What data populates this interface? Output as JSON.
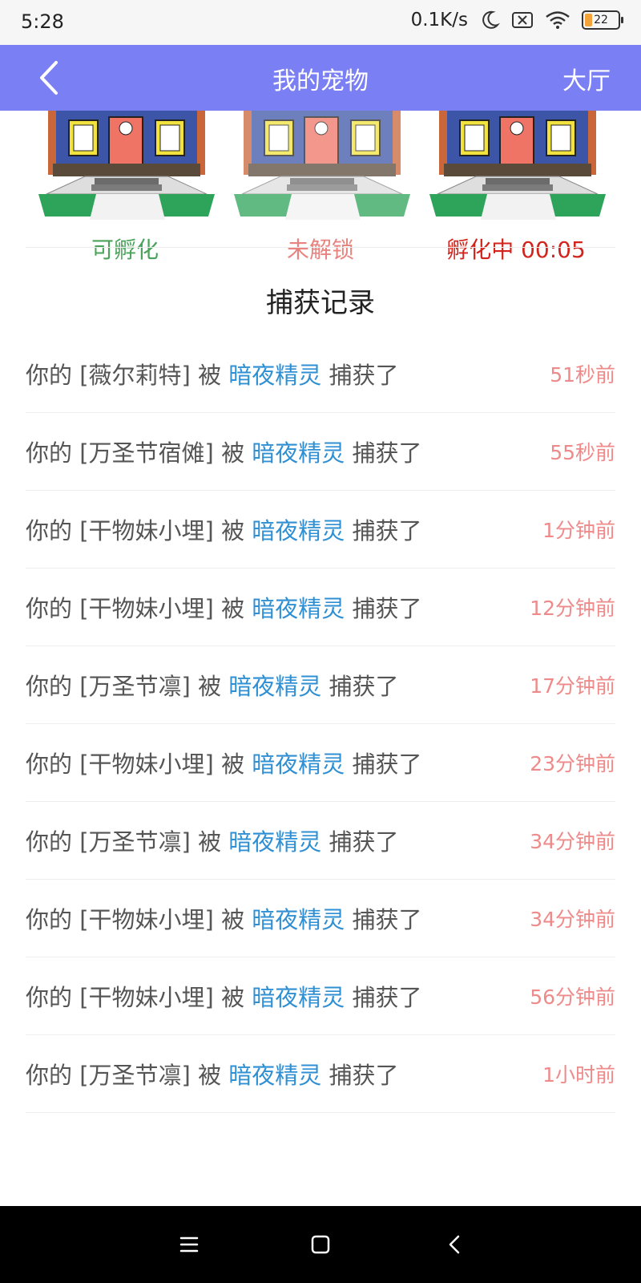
{
  "status_bar": {
    "time": "5:28",
    "network_speed": "0.1K/s",
    "icons": [
      "moon-icon",
      "sim-x-icon",
      "wifi-icon"
    ],
    "battery_level": "22"
  },
  "app_bar": {
    "title": "我的宠物",
    "right_action": "大厅",
    "color": "#7b7ff4"
  },
  "houses": [
    {
      "status": "可孵化",
      "color": "#4aa35a"
    },
    {
      "status": "未解锁",
      "color": "#e8837f"
    },
    {
      "status": "孵化中 00:05",
      "color": "#d2241c"
    }
  ],
  "section_title": "捕获记录",
  "records": [
    {
      "prefix": "你的 [薇尔莉特] 被 ",
      "catcher": "暗夜精灵",
      "suffix": " 捕获了",
      "time": "51秒前"
    },
    {
      "prefix": "你的 [万圣节宿傩] 被 ",
      "catcher": "暗夜精灵",
      "suffix": " 捕获了",
      "time": "55秒前"
    },
    {
      "prefix": "你的 [干物妹小埋] 被 ",
      "catcher": "暗夜精灵",
      "suffix": " 捕获了",
      "time": "1分钟前"
    },
    {
      "prefix": "你的 [干物妹小埋] 被 ",
      "catcher": "暗夜精灵",
      "suffix": " 捕获了",
      "time": "12分钟前"
    },
    {
      "prefix": "你的 [万圣节凛] 被 ",
      "catcher": "暗夜精灵",
      "suffix": " 捕获了",
      "time": "17分钟前"
    },
    {
      "prefix": "你的 [干物妹小埋] 被 ",
      "catcher": "暗夜精灵",
      "suffix": " 捕获了",
      "time": "23分钟前"
    },
    {
      "prefix": "你的 [万圣节凛] 被 ",
      "catcher": "暗夜精灵",
      "suffix": " 捕获了",
      "time": "34分钟前"
    },
    {
      "prefix": "你的 [干物妹小埋] 被 ",
      "catcher": "暗夜精灵",
      "suffix": " 捕获了",
      "time": "34分钟前"
    },
    {
      "prefix": "你的 [干物妹小埋] 被 ",
      "catcher": "暗夜精灵",
      "suffix": " 捕获了",
      "time": "56分钟前"
    },
    {
      "prefix": "你的 [万圣节凛] 被 ",
      "catcher": "暗夜精灵",
      "suffix": " 捕获了",
      "time": "1小时前"
    }
  ],
  "colors": {
    "catcher_text": "#2f8fd3",
    "time_text": "#ef8a8a"
  },
  "nav_bar": {
    "buttons": [
      "menu-icon",
      "home-icon",
      "back-icon"
    ]
  }
}
